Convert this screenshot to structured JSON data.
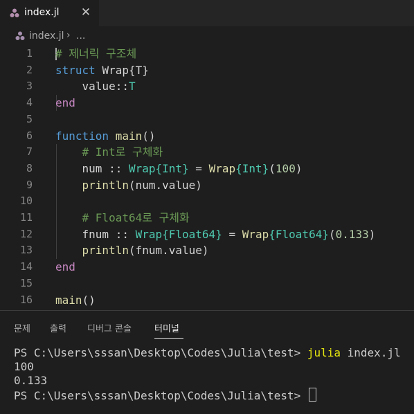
{
  "tab": {
    "label": "index.jl",
    "close": "✕",
    "icon": "julia-dots-icon"
  },
  "breadcrumb": {
    "file": "index.jl",
    "separator": "›",
    "more": "..."
  },
  "editor": {
    "line_numbers": [
      "1",
      "2",
      "3",
      "4",
      "5",
      "6",
      "7",
      "8",
      "9",
      "10",
      "11",
      "12",
      "13",
      "14",
      "15",
      "16"
    ],
    "lines": [
      [
        {
          "t": "# 제너릭 구조체",
          "c": "cm"
        }
      ],
      [
        {
          "t": "struct ",
          "c": "kw"
        },
        {
          "t": "Wrap{T}",
          "c": "id"
        }
      ],
      [
        {
          "t": "    value::",
          "c": "id"
        },
        {
          "t": "T",
          "c": "ty"
        }
      ],
      [
        {
          "t": "end",
          "c": "kw2"
        }
      ],
      [],
      [
        {
          "t": "function ",
          "c": "kw"
        },
        {
          "t": "main",
          "c": "fn"
        },
        {
          "t": "()",
          "c": "id"
        }
      ],
      [
        {
          "t": "    # Int로 구체화",
          "c": "cm"
        }
      ],
      [
        {
          "t": "    num :: ",
          "c": "id"
        },
        {
          "t": "Wrap",
          "c": "ty"
        },
        {
          "t": "{Int}",
          "c": "ty"
        },
        {
          "t": " = ",
          "c": "id"
        },
        {
          "t": "Wrap",
          "c": "fn"
        },
        {
          "t": "{Int}",
          "c": "ty"
        },
        {
          "t": "(",
          "c": "id"
        },
        {
          "t": "100",
          "c": "nm"
        },
        {
          "t": ")",
          "c": "id"
        }
      ],
      [
        {
          "t": "    ",
          "c": "id"
        },
        {
          "t": "println",
          "c": "fn"
        },
        {
          "t": "(num.value)",
          "c": "id"
        }
      ],
      [],
      [
        {
          "t": "    # Float64로 구체화",
          "c": "cm"
        }
      ],
      [
        {
          "t": "    fnum :: ",
          "c": "id"
        },
        {
          "t": "Wrap",
          "c": "ty"
        },
        {
          "t": "{Float64}",
          "c": "ty"
        },
        {
          "t": " = ",
          "c": "id"
        },
        {
          "t": "Wrap",
          "c": "fn"
        },
        {
          "t": "{Float64}",
          "c": "ty"
        },
        {
          "t": "(",
          "c": "id"
        },
        {
          "t": "0.133",
          "c": "nm"
        },
        {
          "t": ")",
          "c": "id"
        }
      ],
      [
        {
          "t": "    ",
          "c": "id"
        },
        {
          "t": "println",
          "c": "fn"
        },
        {
          "t": "(fnum.value)",
          "c": "id"
        }
      ],
      [
        {
          "t": "end",
          "c": "kw2"
        }
      ],
      [],
      [
        {
          "t": "main",
          "c": "fn"
        },
        {
          "t": "()",
          "c": "id"
        }
      ]
    ]
  },
  "panel": {
    "tabs": [
      "문제",
      "출력",
      "디버그 콘솔",
      "터미널"
    ],
    "active_tab": "터미널"
  },
  "terminal": {
    "prompt1": "PS C:\\Users\\sssan\\Desktop\\Codes\\Julia\\test> ",
    "command": "julia",
    "command_arg": " index.jl",
    "output": [
      "100",
      "0.133"
    ],
    "prompt2": "PS C:\\Users\\sssan\\Desktop\\Codes\\Julia\\test> "
  },
  "colors": {
    "background": "#1e1e1e",
    "keyword": "#569cd6",
    "control": "#c586c0",
    "comment": "#6a9955",
    "type": "#4ec9b0",
    "function": "#dcdcaa",
    "number": "#b5cea8"
  }
}
